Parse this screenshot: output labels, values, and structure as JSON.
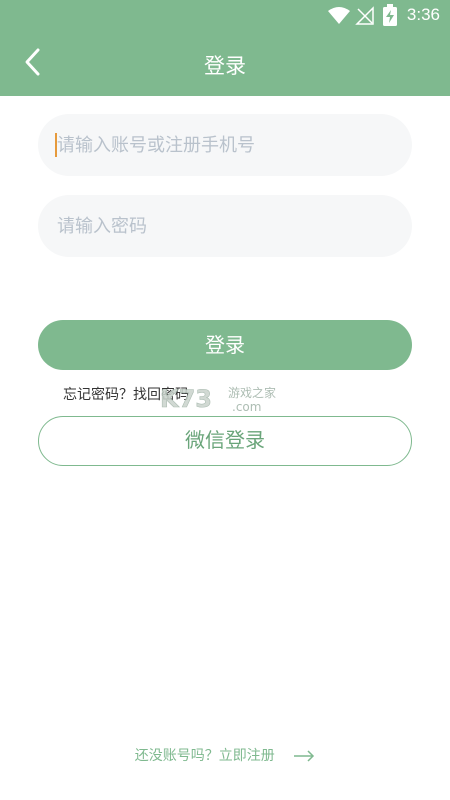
{
  "status_bar": {
    "time": "3:36"
  },
  "header": {
    "title": "登录"
  },
  "form": {
    "account_placeholder": "请输入账号或注册手机号",
    "password_placeholder": "请输入密码",
    "login_label": "登录",
    "forgot_prefix": "忘记密码？",
    "forgot_link": "找回密码",
    "wechat_label": "微信登录"
  },
  "footer": {
    "register_text": "还没账号吗？立即注册"
  },
  "watermark": {
    "text": "K73 游戏之家 .com"
  },
  "colors": {
    "accent": "#7fb98f",
    "field_bg": "#f6f7f8",
    "caret": "#e69a3c"
  }
}
